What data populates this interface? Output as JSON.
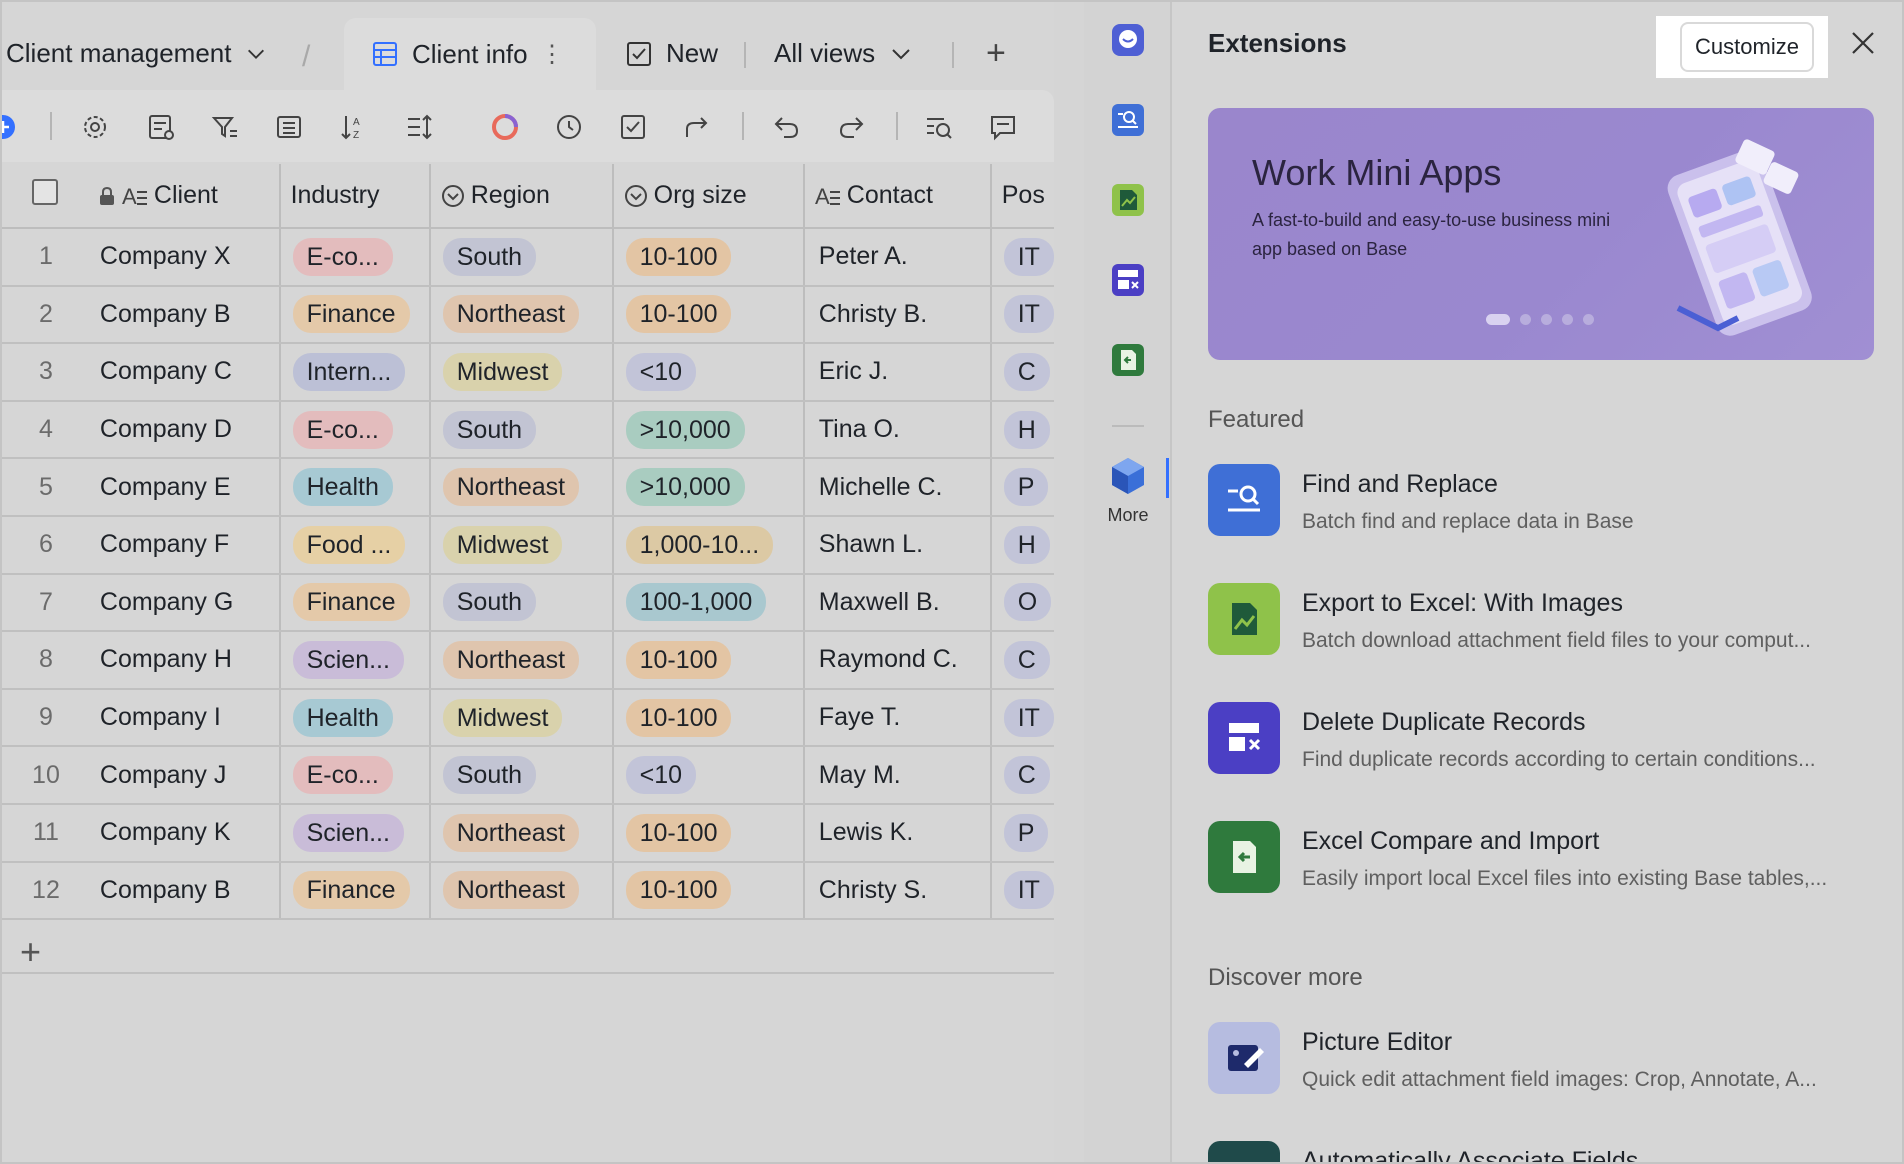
{
  "breadcrumb": {
    "base_name": "Client management"
  },
  "tabs": {
    "active_label": "Client info",
    "new_label": "New",
    "all_views_label": "All views"
  },
  "table": {
    "columns": [
      "Client",
      "Industry",
      "Region",
      "Org size",
      "Contact",
      "Pos"
    ],
    "rows": [
      {
        "n": "1",
        "client": "Company X",
        "industry": "E-co...",
        "region": "South",
        "size": "10-100",
        "contact": "Peter A.",
        "pos": "IT"
      },
      {
        "n": "2",
        "client": "Company B",
        "industry": "Finance",
        "region": "Northeast",
        "size": "10-100",
        "contact": "Christy B.",
        "pos": "IT"
      },
      {
        "n": "3",
        "client": "Company C",
        "industry": "Intern...",
        "region": "Midwest",
        "size": "<10",
        "contact": "Eric J.",
        "pos": "C"
      },
      {
        "n": "4",
        "client": "Company D",
        "industry": "E-co...",
        "region": "South",
        "size": ">10,000",
        "contact": "Tina O.",
        "pos": "H"
      },
      {
        "n": "5",
        "client": "Company E",
        "industry": "Health",
        "region": "Northeast",
        "size": ">10,000",
        "contact": "Michelle C.",
        "pos": "P"
      },
      {
        "n": "6",
        "client": "Company F",
        "industry": "Food ...",
        "region": "Midwest",
        "size": "1,000-10...",
        "contact": "Shawn L.",
        "pos": "H"
      },
      {
        "n": "7",
        "client": "Company G",
        "industry": "Finance",
        "region": "South",
        "size": "100-1,000",
        "contact": "Maxwell B.",
        "pos": "O"
      },
      {
        "n": "8",
        "client": "Company H",
        "industry": "Scien...",
        "region": "Northeast",
        "size": "10-100",
        "contact": "Raymond C.",
        "pos": "C"
      },
      {
        "n": "9",
        "client": "Company I",
        "industry": "Health",
        "region": "Midwest",
        "size": "10-100",
        "contact": "Faye T.",
        "pos": "IT"
      },
      {
        "n": "10",
        "client": "Company J",
        "industry": "E-co...",
        "region": "South",
        "size": "<10",
        "contact": "May M.",
        "pos": "C"
      },
      {
        "n": "11",
        "client": "Company K",
        "industry": "Scien...",
        "region": "Northeast",
        "size": "10-100",
        "contact": "Lewis K.",
        "pos": "P"
      },
      {
        "n": "12",
        "client": "Company B",
        "industry": "Finance",
        "region": "Northeast",
        "size": "10-100",
        "contact": "Christy S.",
        "pos": "IT"
      }
    ]
  },
  "pill_colors": {
    "E-co...": "#e3bcbd",
    "Finance": "#e4c9a9",
    "Intern...": "#bcc0d6",
    "Health": "#a7c9d3",
    "Food ...": "#e6d0a5",
    "Scien...": "#c9bcd8",
    "South": "#c2c4d3",
    "Northeast": "#dfc5ae",
    "Midwest": "#d9d2ac",
    "10-100": "#e3c5a4",
    "<10": "#c2c4d8",
    ">10,000": "#a9ccc0",
    "1,000-10...": "#dcc9a4",
    "100-1,000": "#a9c8cf"
  },
  "rail": {
    "more_label": "More"
  },
  "extensions": {
    "title": "Extensions",
    "customize_label": "Customize",
    "banner": {
      "title": "Work Mini Apps",
      "desc": "A fast-to-build and easy-to-use business mini app based on Base"
    },
    "featured_label": "Featured",
    "featured": [
      {
        "title": "Find and Replace",
        "desc": "Batch find and replace data in Base",
        "icon": "find-replace-icon",
        "color": "#3f6fd6"
      },
      {
        "title": "Export to Excel: With Images",
        "desc": "Batch download attachment field files to your comput...",
        "icon": "export-excel-icon",
        "color": "#8fc24a"
      },
      {
        "title": "Delete Duplicate Records",
        "desc": "Find duplicate records according to certain conditions...",
        "icon": "delete-duplicate-icon",
        "color": "#4b3fc4"
      },
      {
        "title": "Excel Compare and Import",
        "desc": "Easily import local Excel files into existing Base tables,...",
        "icon": "excel-import-icon",
        "color": "#2f7a3d"
      }
    ],
    "discover_label": "Discover more",
    "discover": [
      {
        "title": "Picture Editor",
        "desc": "Quick edit attachment field images: Crop, Annotate, A...",
        "icon": "picture-editor-icon",
        "color": "#b6bce0"
      },
      {
        "title": "Automatically Associate Fields",
        "desc": "",
        "icon": "associate-fields-icon",
        "color": "#1f4a4a"
      }
    ]
  }
}
